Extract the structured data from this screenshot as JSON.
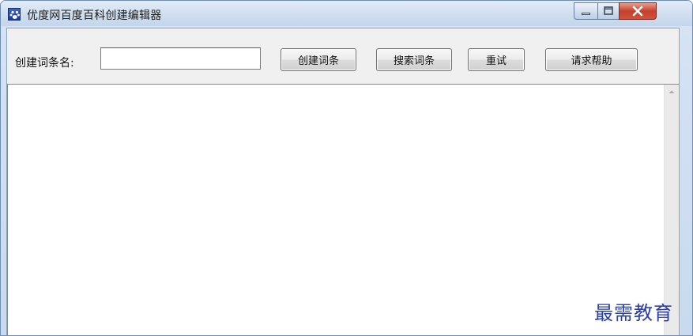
{
  "window": {
    "title": "优度网百度百科创建编辑器",
    "icon": "app-paw-icon",
    "controls": [
      "minimize-icon",
      "maximize-icon",
      "close-icon"
    ]
  },
  "form": {
    "name_label": "创建词条名:",
    "name_value": "",
    "buttons": {
      "create": "创建词条",
      "search": "搜索词条",
      "reset": "重试",
      "help": "请求帮助"
    }
  },
  "editor": {
    "content": ""
  },
  "watermark": "最需教育",
  "colors": {
    "titlebar": "#cfdeef",
    "close_button": "#c7402c",
    "watermark": "#2a3fa8"
  }
}
